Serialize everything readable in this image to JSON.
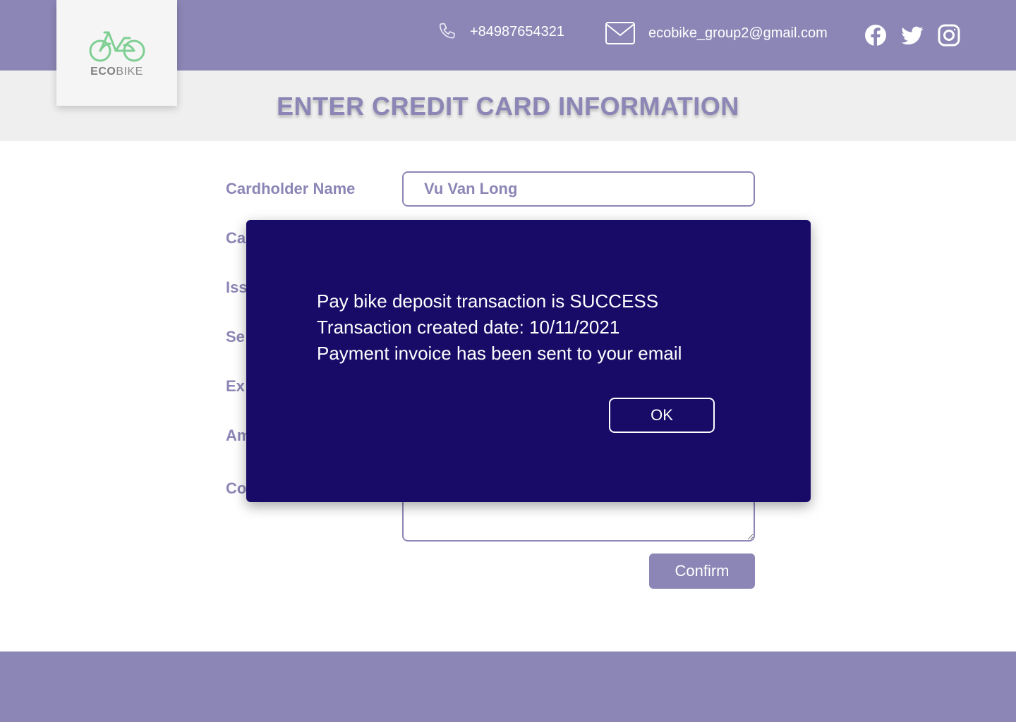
{
  "header": {
    "logo": {
      "eco": "ECO",
      "bike": "BIKE"
    },
    "phone": "+84987654321",
    "email": "ecobike_group2@gmail.com",
    "socials": [
      "facebook-icon",
      "twitter-icon",
      "instagram-icon"
    ]
  },
  "page_title": "ENTER CREDIT CARD INFORMATION",
  "form": {
    "cardholder_label": "Cardholder Name",
    "cardholder_value": "Vu Van Long",
    "partial_labels": [
      "Ca",
      "Iss",
      "Se",
      "Ex",
      "Am",
      "Co"
    ],
    "confirm_label": "Confirm"
  },
  "modal": {
    "lines": [
      "Pay bike deposit transaction is SUCCESS",
      "Transaction created date: 10/11/2021",
      "Payment invoice has been sent to your email"
    ],
    "ok_label": "OK"
  },
  "colors": {
    "brand": "#8b86b5",
    "modal_bg": "#170b67",
    "logo_green": "#6fcf8a"
  }
}
